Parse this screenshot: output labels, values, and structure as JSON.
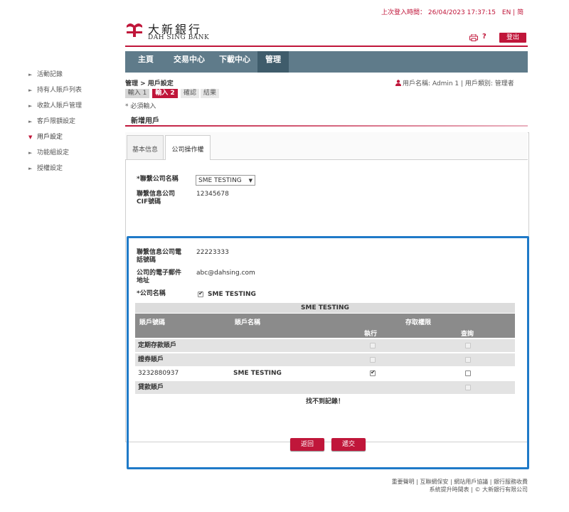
{
  "header": {
    "last_login": "上次登入時間： 26/04/2023 17:37:15",
    "lang_links": "EN | 简",
    "logo_cn": "大新銀行",
    "logo_en": "DAH SING BANK",
    "help": "?",
    "logout": "登出"
  },
  "nav": {
    "items": [
      {
        "label": "主頁"
      },
      {
        "label": "交易中心"
      },
      {
        "label": "下載中心"
      },
      {
        "label": "管理"
      }
    ]
  },
  "sidebar": {
    "items": [
      {
        "label": "活動記錄"
      },
      {
        "label": "持有人賬戶列表"
      },
      {
        "label": "收款人賬戶管理"
      },
      {
        "label": "客戶限額設定"
      },
      {
        "label": "用戶設定"
      },
      {
        "label": "功能組設定"
      },
      {
        "label": "授權設定"
      }
    ]
  },
  "page": {
    "breadcrumb": "管理 > 用戶設定",
    "user_info": "用戶名稱: Admin 1 | 用戶類別: 管理者",
    "steps": [
      "輸入 1",
      "輸入 2",
      "確認",
      "結果"
    ],
    "required_note": "* 必須輸入",
    "section_title": "新增用戶",
    "tabs": [
      {
        "label": "基本信息"
      },
      {
        "label": "公司操作權"
      }
    ]
  },
  "form": {
    "company_name_label": "*聯繫公司名稱",
    "company_select_value": "SME TESTING",
    "cif_label_1": "聯繫信息公司",
    "cif_label_2": "CIF號碼",
    "cif_value": "12345678",
    "phone_label_1": "聯繫信息公司電",
    "phone_label_2": "話號碼",
    "phone_value": "22223333",
    "email_label_1": "公司的電子郵件",
    "email_label_2": "地址",
    "email_value": "abc@dahsing.com",
    "company_label": "*公司名稱",
    "company_checkbox_text": "SME TESTING"
  },
  "table": {
    "title": "SME TESTING",
    "col_account_no": "賬戶號碼",
    "col_account_name": "賬戶名稱",
    "col_access": "存取權限",
    "col_execute": "執行",
    "col_query": "查詢",
    "rows": [
      {
        "account_no": "定期存款賬戶",
        "account_name": "",
        "execute": false,
        "query": false,
        "group": true
      },
      {
        "account_no": "證券賬戶",
        "account_name": "",
        "execute": false,
        "query": false,
        "group": true
      },
      {
        "account_no": "3232880937",
        "account_name": "SME TESTING",
        "execute": true,
        "query": false,
        "group": false
      },
      {
        "account_no": "貸款賬戶",
        "account_name": "",
        "execute": false,
        "query": false,
        "group": true
      }
    ],
    "no_records": "找不到記錄！"
  },
  "buttons": {
    "back": "返回",
    "submit": "遞交"
  },
  "footer": {
    "line1": "重要聲明 | 互聯網保安 | 網站用戶協議 | 銀行服務收費",
    "line2": "系統提升時間表 | © 大新銀行有限公司"
  },
  "colors": {
    "brand_red": "#c0163a",
    "nav_bg": "#5f7b8a",
    "highlight_blue": "#1f7ac8"
  }
}
